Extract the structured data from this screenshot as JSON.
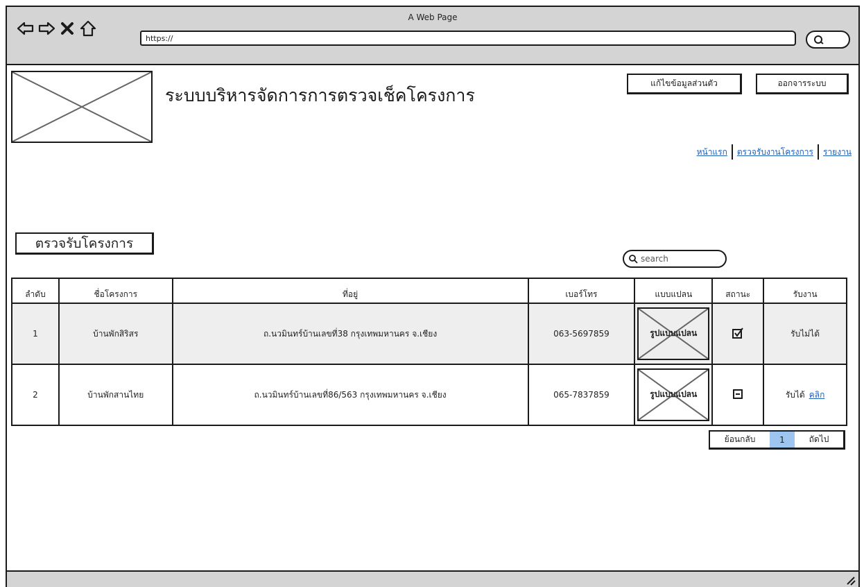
{
  "browser": {
    "window_title": "A Web Page",
    "url": "https://"
  },
  "header": {
    "site_title": "ระบบบริหารจัดการการตรวจเช็คโครงการ",
    "edit_profile_label": "แก้ไขข้อมูลส่วนตัว",
    "logout_label": "ออกจารระบบ"
  },
  "nav": {
    "items": [
      {
        "label": "หน้าแรก"
      },
      {
        "label": "ตรวจรับงานโครงการ"
      },
      {
        "label": "รายงาน"
      }
    ]
  },
  "section": {
    "title": "ตรวจรับโครงการ"
  },
  "search": {
    "placeholder": "search"
  },
  "table": {
    "headers": [
      "ลำดับ",
      "ชื่อโครงการ",
      "ที่อยู่",
      "เบอร์โทร",
      "แบบแปลน",
      "สถานะ",
      "รับงาน"
    ],
    "rows": [
      {
        "no": "1",
        "name": "บ้านพักสิริสร",
        "address": "ถ.นวมินทร์บ้านเลขที่38 กรุงเทพมหานคร จ.เชียง",
        "phone": "063-5697859",
        "plan": "รูปแบบแปลน",
        "status_icon": "checked-box-icon",
        "accept": "รับไม่ได้",
        "accept_link": ""
      },
      {
        "no": "2",
        "name": "บ้านพักสานไทย",
        "address": "ถ.นวมินทร์บ้านเลขที่86/563 กรุงเทพมหานคร จ.เชียง",
        "phone": "065-7837859",
        "plan": "รูปแบบแปลน",
        "status_icon": "minus-box-icon",
        "accept": "รับได้",
        "accept_link": "คลิก"
      }
    ]
  },
  "pager": {
    "prev_label": "ย้อนกลับ",
    "current_page": "1",
    "next_label": "ถัดไป"
  },
  "colors": {
    "link": "#1f5fb8",
    "chrome": "#d4d4d4",
    "row_highlight": "#eeeeee",
    "active_page": "#9ec5f0"
  }
}
